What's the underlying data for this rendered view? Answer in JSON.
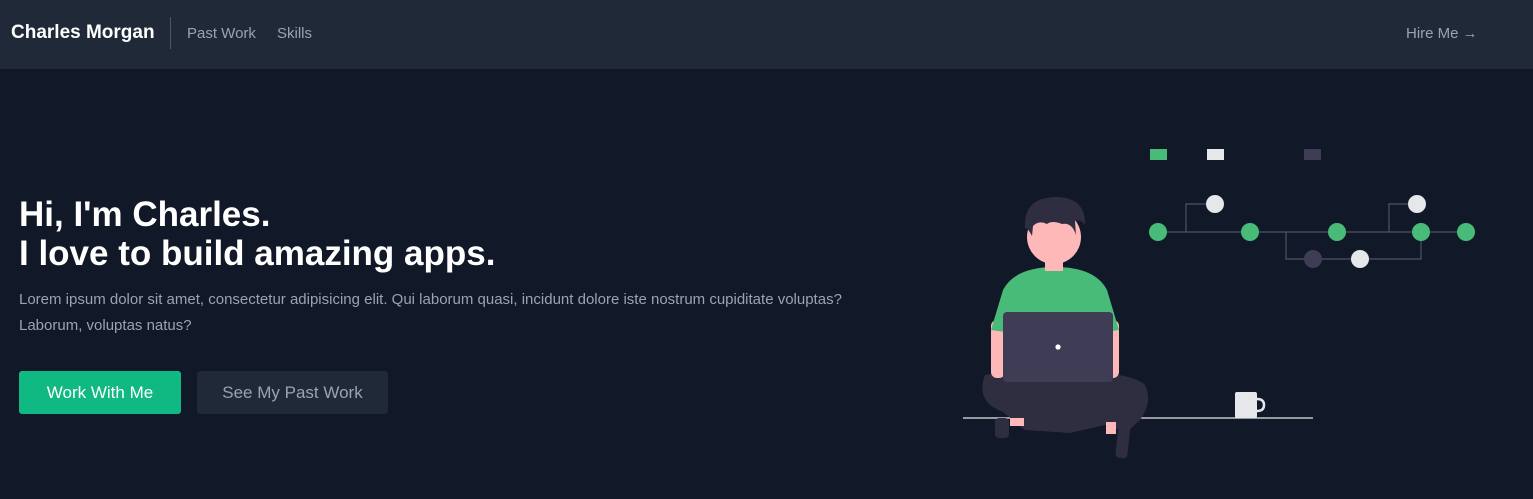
{
  "navbar": {
    "brand": "Charles Morgan",
    "links": [
      {
        "label": "Past Work"
      },
      {
        "label": "Skills"
      }
    ],
    "hire_label": "Hire Me",
    "hire_icon": "→"
  },
  "hero": {
    "title_line1": "Hi, I'm Charles.",
    "title_line2": "I love to build amazing apps.",
    "description": "Lorem ipsum dolor sit amet, consectetur adipisicing elit. Qui laborum quasi, incidunt dolore iste nostrum cupiditate voluptas? Laborum, voluptas natus?",
    "primary_button": "Work With Me",
    "secondary_button": "See My Past Work"
  },
  "illustration": {
    "name": "person-with-laptop-illustration",
    "colors": {
      "accent_green": "#48bb78",
      "light_gray": "#e5e7eb",
      "dark_purple": "#3f3d56",
      "skin": "#ffb8b8",
      "hair": "#2f2e41"
    }
  },
  "colors": {
    "page_bg": "#111827",
    "navbar_bg": "#1f2937",
    "primary": "#10b981",
    "muted_text": "#9ca3af"
  }
}
